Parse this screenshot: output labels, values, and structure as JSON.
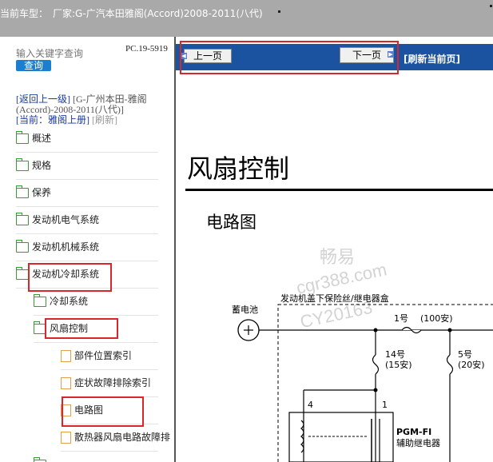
{
  "header": {
    "label": "当前车型：",
    "value": "厂家:G-广汽本田雅阁(Accord)2008-2011(八代)"
  },
  "sidebar": {
    "search_placeholder": "输入关键字查询",
    "search_button": "查询",
    "pc_code": "PC.19-5919",
    "back_link": "[返回上一级]",
    "parent_title": "[G-广州本田-雅阁(Accord)-2008-2011(八代)]",
    "current_label": "[当前：",
    "current_value": "雅阁上册]",
    "refresh_link": "[刷新]",
    "items": [
      {
        "label": "概述"
      },
      {
        "label": "规格"
      },
      {
        "label": "保养"
      },
      {
        "label": "发动机电气系统"
      },
      {
        "label": "发动机机械系统"
      },
      {
        "label": "发动机冷却系统"
      },
      {
        "label": "冷却系统"
      },
      {
        "label": "风扇控制"
      },
      {
        "label": "部件位置索引"
      },
      {
        "label": "症状故障排除索引"
      },
      {
        "label": "电路图"
      },
      {
        "label": "散热器风扇电路故障排"
      }
    ]
  },
  "toolbar": {
    "prev": "上一页",
    "next": "下一页",
    "refresh": "[刷新当前页]"
  },
  "content": {
    "title": "风扇控制",
    "subtitle": "电路图",
    "watermark": [
      "畅易",
      "cgr388.com",
      "CY20163"
    ],
    "diagram": {
      "battery_label": "蓄电池",
      "fusebox_label": "发动机盖下保险丝/继电器盒",
      "fuse1_num": "1号",
      "fuse1_amp": "(100安)",
      "fuse14_num": "14号",
      "fuse14_amp": "(15安)",
      "fuse5_num": "5号",
      "fuse5_amp": "(20安)",
      "pin4": "4",
      "pin1": "1",
      "relay_name": "PGM-FI",
      "relay_desc": "辅助继电器"
    }
  }
}
